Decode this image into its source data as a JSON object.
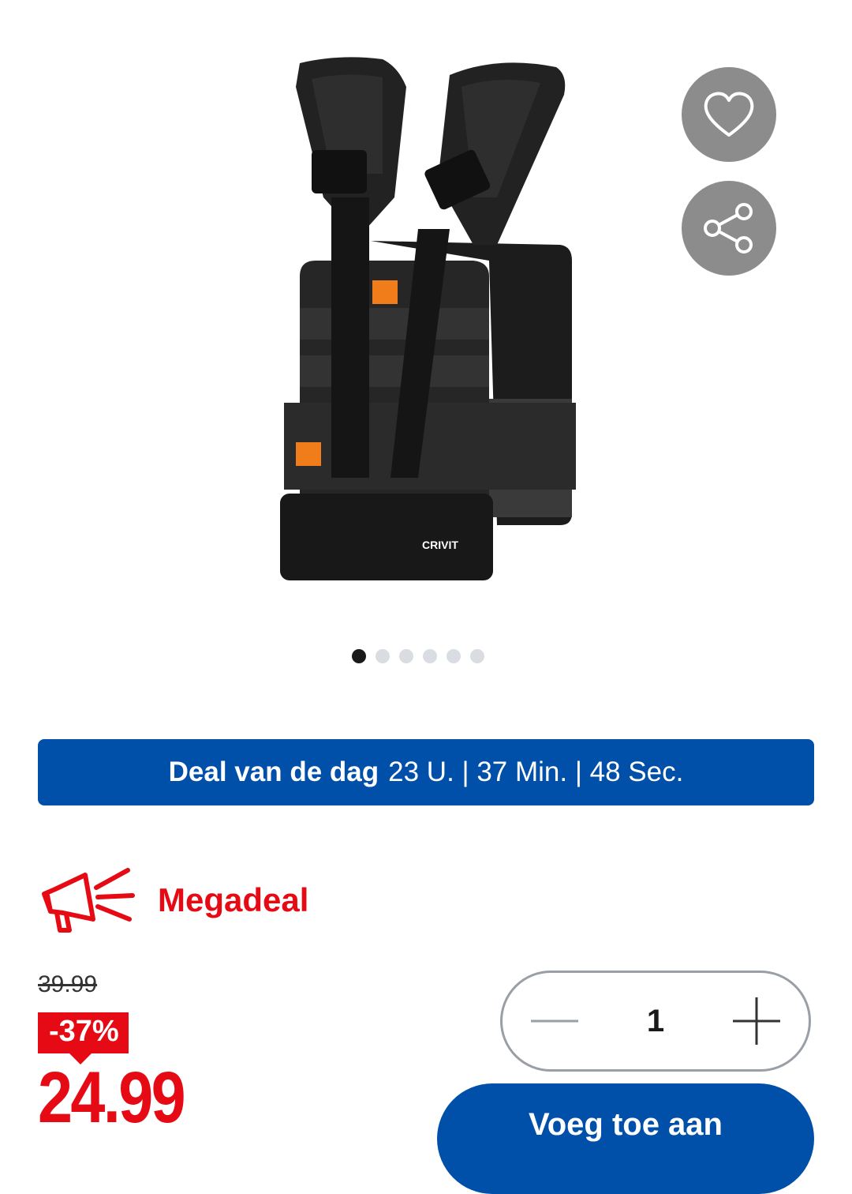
{
  "product": {
    "brand_mark": "CRIVIT",
    "image_icon": "product-photo-chest-rig"
  },
  "actions": {
    "wishlist_icon": "heart-icon",
    "share_icon": "share-icon"
  },
  "carousel": {
    "count": 6,
    "active_index": 0
  },
  "deal": {
    "title": "Deal van de dag",
    "countdown": "23 U. | 37 Min. | 48 Sec."
  },
  "megadeal": {
    "icon": "megaphone-icon",
    "label": "Megadeal"
  },
  "pricing": {
    "old_price": "39.99",
    "discount": "-37%",
    "price": "24.99"
  },
  "quantity": {
    "value": "1",
    "minus_icon": "minus-icon",
    "plus_icon": "plus-icon"
  },
  "cart": {
    "button_label": "Voeg toe aan"
  },
  "colors": {
    "brand_blue": "#0050aa",
    "sale_red": "#e60a14",
    "icon_grey": "#8c8c8c"
  }
}
